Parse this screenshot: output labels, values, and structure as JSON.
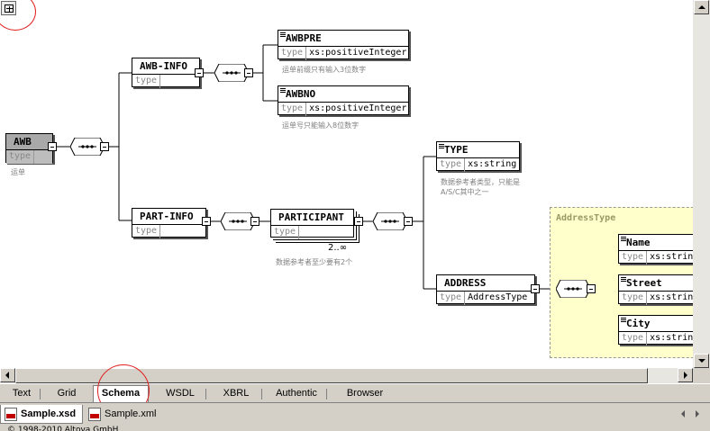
{
  "window": {
    "title": ""
  },
  "schema": {
    "root": {
      "name": "AWB",
      "type_key": "type",
      "type_value": "",
      "note": "运单"
    },
    "awb_info": {
      "name": "AWB-INFO",
      "type_key": "type",
      "type_value": ""
    },
    "awbpre": {
      "name": "AWBPRE",
      "type_key": "type",
      "type_value": "xs:positiveInteger",
      "note": "运单前缀只有输入3位数字"
    },
    "awbno": {
      "name": "AWBNO",
      "type_key": "type",
      "type_value": "xs:positiveInteger",
      "note": "运单号只能输入8位数字"
    },
    "part_info": {
      "name": "PART-INFO",
      "type_key": "type",
      "type_value": ""
    },
    "participant": {
      "name": "PARTICIPANT",
      "type_key": "type",
      "type_value": "",
      "cardinality": "2..∞",
      "note": "数据参考者至少要有2个"
    },
    "type_el": {
      "name": "TYPE",
      "type_key": "type",
      "type_value": "xs:string",
      "note_line1": "数据参考者类型，只能是",
      "note_line2": "A/S/C其中之一"
    },
    "address": {
      "name": "ADDRESS",
      "type_key": "type",
      "type_value": "AddressType"
    },
    "address_type": {
      "label": "AddressType",
      "children": [
        {
          "name": "Name",
          "type_key": "type",
          "type_value": "xs:string"
        },
        {
          "name": "Street",
          "type_key": "type",
          "type_value": "xs:string"
        },
        {
          "name": "City",
          "type_key": "type",
          "type_value": "xs:string"
        }
      ]
    }
  },
  "view_tabs": [
    "Text",
    "Grid",
    "Schema",
    "WSDL",
    "XBRL",
    "Authentic",
    "Browser"
  ],
  "active_view_tab": "Schema",
  "file_tabs": [
    {
      "label": "Sample.xsd",
      "active": true
    },
    {
      "label": "Sample.xml",
      "active": false
    }
  ],
  "status_bar": "© 1998-2010 Altova GmbH",
  "colors": {
    "annotation": "#e02020",
    "complex_type_bg": "#ffffcc",
    "root_bg": "#a9a9a9"
  }
}
